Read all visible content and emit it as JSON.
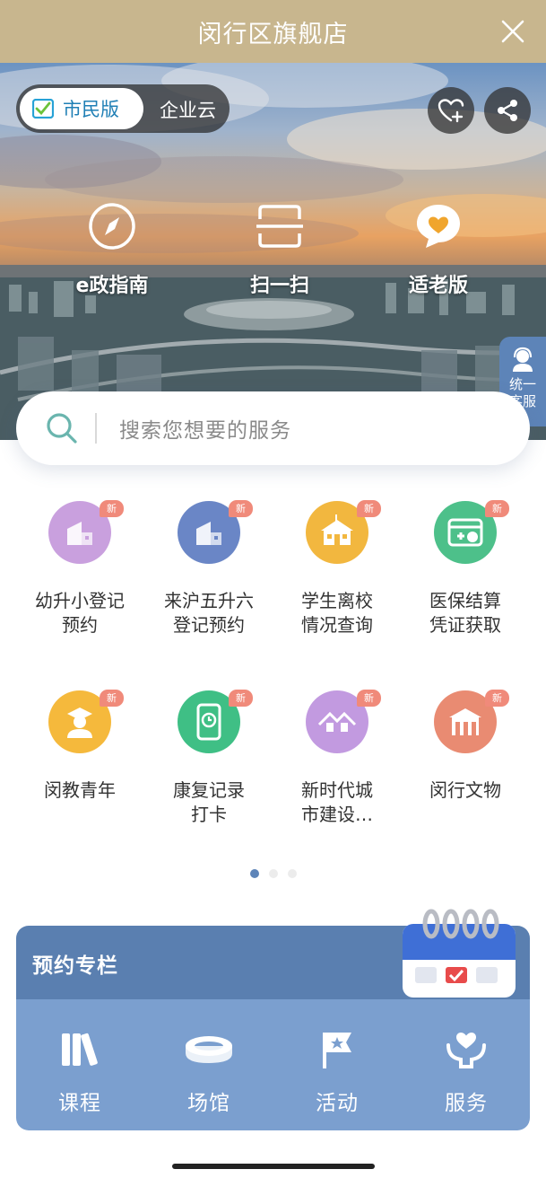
{
  "titlebar": {
    "title": "闵行区旗舰店",
    "close_icon": "close-icon"
  },
  "hero": {
    "version_active": "市民版",
    "version_inactive": "企业云",
    "quick_actions": [
      {
        "label": "e政指南",
        "icon": "compass-icon"
      },
      {
        "label": "扫一扫",
        "icon": "scan-icon"
      },
      {
        "label": "适老版",
        "icon": "heart-bubble-icon"
      }
    ],
    "favorite_icon": "heart-plus-icon",
    "share_icon": "share-icon",
    "customer_service": "统一\n客服"
  },
  "search": {
    "placeholder": "搜索您想要的服务"
  },
  "services": [
    {
      "line1": "幼升小登记",
      "line2": "预约",
      "badge": "新",
      "color": "#c9a0de"
    },
    {
      "line1": "来沪五升六",
      "line2": "登记预约",
      "badge": "新",
      "color": "#6a86c6"
    },
    {
      "line1": "学生离校",
      "line2": "情况查询",
      "badge": "新",
      "color": "#f2b73f"
    },
    {
      "line1": "医保结算",
      "line2": "凭证获取",
      "badge": "新",
      "color": "#4dc08a"
    },
    {
      "line1": "闵教青年",
      "line2": "",
      "badge": "新",
      "color": "#f5b93c"
    },
    {
      "line1": "康复记录",
      "line2": "打卡",
      "badge": "新",
      "color": "#3fbf85"
    },
    {
      "line1": "新时代城",
      "line2": "市建设…",
      "badge": "新",
      "color": "#c29ae0"
    },
    {
      "line1": "闵行文物",
      "line2": "",
      "badge": "新",
      "color": "#e98b72"
    }
  ],
  "pagination": {
    "current": 1,
    "total": 3
  },
  "reservation": {
    "title": "预约专栏",
    "items": [
      {
        "label": "课程",
        "icon": "books-icon"
      },
      {
        "label": "场馆",
        "icon": "stadium-icon"
      },
      {
        "label": "活动",
        "icon": "flag-icon"
      },
      {
        "label": "服务",
        "icon": "hands-heart-icon"
      }
    ]
  },
  "colors": {
    "gold": "#c8b68e",
    "blue": "#5a7fb0",
    "light_blue": "#7b9fcf",
    "badge": "#f08a7a"
  }
}
